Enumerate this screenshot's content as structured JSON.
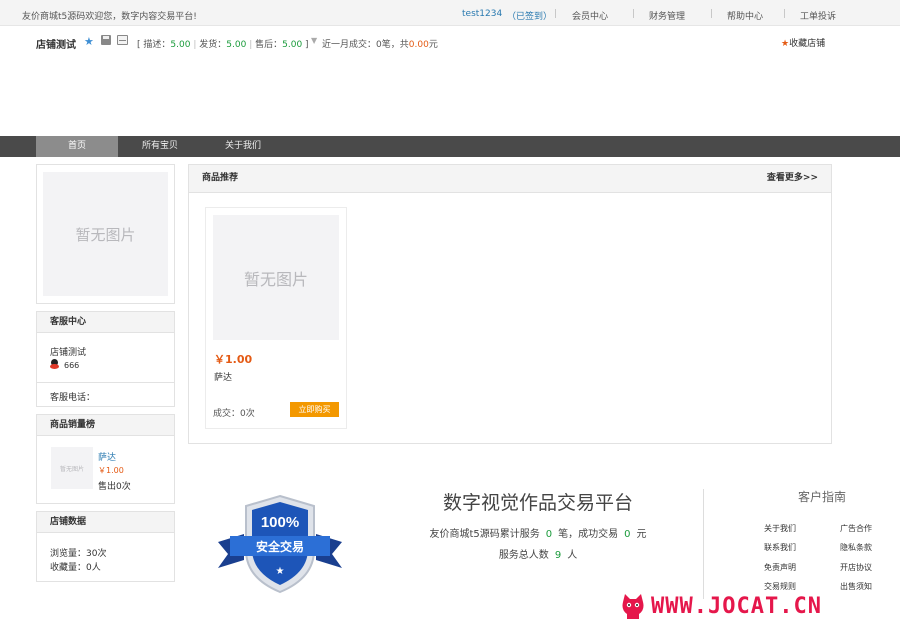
{
  "topbar": {
    "welcome": "友价商城t5源码欢迎您，数字内容交易平台!",
    "username": "test1234",
    "signed_in": "（已签到）",
    "links": [
      "会员中心",
      "财务管理",
      "帮助中心",
      "工单投诉"
    ]
  },
  "shop": {
    "name": "店铺测试",
    "ratings": {
      "open": "[",
      "desc_label": "描述：",
      "desc_value": "5.00",
      "ship_label": "发货：",
      "ship_value": "5.00",
      "after_label": "售后：",
      "after_value": "5.00",
      "close": "]"
    },
    "month_sales_prefix": "近一月成交：",
    "month_sales_count": "0笔",
    "month_sales_mid": "，共",
    "month_sales_amount": "0.00",
    "month_sales_unit": "元",
    "favorite": "收藏店铺"
  },
  "nav": {
    "items": [
      "首页",
      "所有宝贝",
      "关于我们"
    ],
    "active_index": 0
  },
  "sidebar": {
    "logo_placeholder": "暂无图片",
    "service": {
      "title": "客服中心",
      "shop_name": "店铺测试",
      "qq": "666",
      "phone_label": "客服电话："
    },
    "rank": {
      "title": "商品销量榜",
      "thumb_placeholder": "暂无图片",
      "item_name": "萨达",
      "item_price": "￥1.00",
      "item_sold": "售出0次"
    },
    "stats": {
      "title": "店铺数据",
      "views": "浏览量：30次",
      "favorites": "收藏量：0人"
    }
  },
  "main": {
    "section_title": "商品推荐",
    "more_label": "查看更多>>",
    "products": [
      {
        "image_placeholder": "暂无图片",
        "price": "￥1.00",
        "name": "萨达",
        "sold": "成交：0次",
        "buy_label": "立即购买"
      }
    ]
  },
  "footer": {
    "badge": {
      "percent": "100%",
      "text": "安全交易"
    },
    "platform_title": "数字视觉作品交易平台",
    "stats_prefix": "友价商城t5源码累计服务",
    "stats_orders": "0",
    "stats_mid": "笔，成功交易",
    "stats_success": "0",
    "stats_unit": "元",
    "users_label": "服务总人数",
    "users_count": "9",
    "users_unit": "人",
    "guide_title": "客户指南",
    "guide_links": [
      "关于我们",
      "广告合作",
      "联系我们",
      "隐私条款",
      "免责声明",
      "开店协议",
      "交易规则",
      "出售须知"
    ]
  },
  "watermark": {
    "text": "WWW.JOCAT.CN"
  },
  "colors": {
    "accent_orange": "#f39800",
    "price_red": "#e45a14",
    "nav_bg": "#4a4a4a",
    "nav_active": "#8c8c8c",
    "link_blue": "#2a7ab0",
    "green_value": "#1a9b3b",
    "watermark_pink": "#e5174b"
  },
  "icons": {
    "favorite": "star-icon",
    "save": "save-icon",
    "message": "message-icon",
    "qq": "qq-icon",
    "watermark_logo": "cat-icon"
  }
}
